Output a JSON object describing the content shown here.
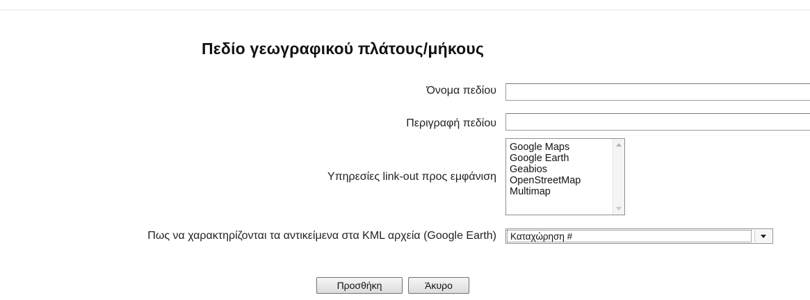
{
  "form": {
    "title": "Πεδίο γεωγραφικού πλάτους/μήκους",
    "field_name": {
      "label": "Όνομα πεδίου",
      "value": ""
    },
    "field_description": {
      "label": "Περιγραφή πεδίου",
      "value": ""
    },
    "linkout_services": {
      "label": "Υπηρεσίες link-out προς εμφάνιση",
      "options": [
        "Google Maps",
        "Google Earth",
        "Geabios",
        "OpenStreetMap",
        "Multimap"
      ]
    },
    "kml_label": {
      "label": "Πως να χαρακτηρίζονται τα αντικείμενα στα KML αρχεία (Google Earth)",
      "selected": "Καταχώρηση #"
    }
  },
  "buttons": {
    "add": "Προσθήκη",
    "cancel": "Άκυρο"
  }
}
